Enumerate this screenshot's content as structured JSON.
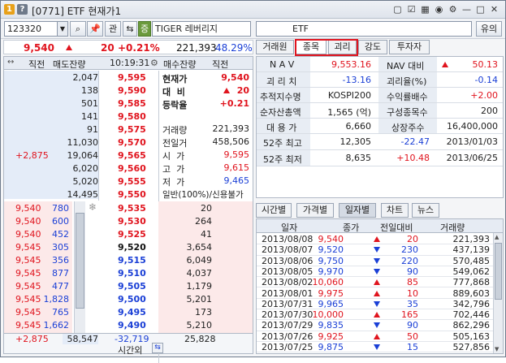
{
  "window": {
    "code_label": "[0771]",
    "title": "ETF 현재가1"
  },
  "toolbar": {
    "code": "123320",
    "btn_search": "⌕",
    "btn_pin": "📌",
    "btn_gwan": "관",
    "btn_arrows": "⇆",
    "btn_jeung": "증",
    "name": "TIGER 레버리지",
    "etf_label": "ETF",
    "btn_yui": "유의"
  },
  "price_bar": {
    "price": "9,540",
    "change": "20",
    "pct": "+0.21%",
    "volume": "221,393",
    "ratio": "48.29%"
  },
  "orderbook_header": {
    "c1": "직전",
    "c2": "매도잔량",
    "time": "10:19:31",
    "c4": "매수잔량",
    "c5": "직전"
  },
  "asks": [
    {
      "qty": "2,047",
      "price": "9,595"
    },
    {
      "qty": "138",
      "price": "9,590"
    },
    {
      "qty": "501",
      "price": "9,585"
    },
    {
      "qty": "141",
      "price": "9,580"
    },
    {
      "qty": "91",
      "price": "9,575"
    },
    {
      "qty": "11,030",
      "price": "9,570"
    },
    {
      "prev": "+2,875",
      "qty": "19,064",
      "price": "9,565"
    },
    {
      "qty": "6,020",
      "price": "9,560"
    },
    {
      "qty": "5,020",
      "price": "9,555"
    },
    {
      "qty": "14,495",
      "price": "9,550"
    }
  ],
  "ask_info": {
    "cur_label": "현재가",
    "cur_val": "9,540",
    "diff_label": "대  비",
    "diff_val": "20",
    "rate_label": "등락율",
    "rate_val": "+0.21",
    "items": [
      {
        "label": "거래량",
        "value": "221,393"
      },
      {
        "label": "전일거",
        "value": "458,506"
      },
      {
        "label": "시  가",
        "value": "9,595"
      },
      {
        "label": "고  가",
        "value": "9,615"
      },
      {
        "label": "저  가",
        "value": "9,465"
      }
    ],
    "footer": "일반(100%)/신용불가"
  },
  "bids": [
    {
      "p1": "9,540",
      "p2": "780",
      "price": "9,535",
      "qty": "20"
    },
    {
      "p1": "9,540",
      "p2": "600",
      "price": "9,530",
      "qty": "264"
    },
    {
      "p1": "9,540",
      "p2": "452",
      "price": "9,525",
      "qty": "41"
    },
    {
      "p1": "9,545",
      "p2": "305",
      "price": "9,520",
      "qty": "3,654"
    },
    {
      "p1": "9,545",
      "p2": "356",
      "price": "9,515",
      "qty": "6,049"
    },
    {
      "p1": "9,545",
      "p2": "877",
      "price": "9,510",
      "qty": "4,037"
    },
    {
      "p1": "9,545",
      "p2": "477",
      "price": "9,505",
      "qty": "1,179"
    },
    {
      "p1": "9,545",
      "p2": "1,828",
      "price": "9,500",
      "qty": "5,201"
    },
    {
      "p1": "9,545",
      "p2": "765",
      "price": "9,495",
      "qty": "173"
    },
    {
      "p1": "9,545",
      "p2": "1,662",
      "price": "9,490",
      "qty": "5,210"
    }
  ],
  "ob_footer": {
    "prev": "+2,875",
    "ask_total": "58,547",
    "diff": "-32,719",
    "bid_total": "25,828",
    "time_label": "시간외"
  },
  "right_tabs": [
    "거래원",
    "종목",
    "괴리",
    "강도",
    "투자자"
  ],
  "info": [
    {
      "l1": "N A V",
      "v1": "9,553.16",
      "l2": "NAV 대비",
      "v2": "50.13"
    },
    {
      "l1": "괴 리 치",
      "v1": "-13.16",
      "l2": "괴리율(%)",
      "v2": "-0.14"
    },
    {
      "l1": "추적지수명",
      "v1": "KOSPI200",
      "l2": "수익률배수",
      "v2": "+2.00"
    },
    {
      "l1": "순자산총액",
      "v1": "1,565 (억)",
      "l2": "구성종목수",
      "v2": "200"
    },
    {
      "l1": "대 용 가",
      "v1": "6,660",
      "l2": "상장주수",
      "v2": "16,400,000"
    },
    {
      "l1": "52주 최고",
      "v1": "12,305",
      "l2": "-22.47",
      "v2": "2013/01/03"
    },
    {
      "l1": "52주 최저",
      "v1": "8,635",
      "l2": "+10.48",
      "v2": "2013/06/25"
    }
  ],
  "sub_tabs": [
    "시간별",
    "가격별",
    "일자별",
    "차트",
    "뉴스"
  ],
  "list_head": {
    "date": "일자",
    "close": "종가",
    "change": "전일대비",
    "volume": "거래량"
  },
  "daily": [
    {
      "date": "2013/08/08",
      "close": "9,540",
      "dir": "up",
      "change": "20",
      "volume": "221,393"
    },
    {
      "date": "2013/08/07",
      "close": "9,520",
      "dir": "down",
      "change": "230",
      "volume": "437,139"
    },
    {
      "date": "2013/08/06",
      "close": "9,750",
      "dir": "down",
      "change": "220",
      "volume": "570,485"
    },
    {
      "date": "2013/08/05",
      "close": "9,970",
      "dir": "down",
      "change": "90",
      "volume": "549,062"
    },
    {
      "date": "2013/08/02",
      "close": "10,060",
      "dir": "up",
      "change": "85",
      "volume": "777,868"
    },
    {
      "date": "2013/08/01",
      "close": "9,975",
      "dir": "up",
      "change": "10",
      "volume": "889,603"
    },
    {
      "date": "2013/07/31",
      "close": "9,965",
      "dir": "down",
      "change": "35",
      "volume": "342,796"
    },
    {
      "date": "2013/07/30",
      "close": "10,000",
      "dir": "up",
      "change": "165",
      "volume": "702,446"
    },
    {
      "date": "2013/07/29",
      "close": "9,835",
      "dir": "down",
      "change": "90",
      "volume": "862,296"
    },
    {
      "date": "2013/07/26",
      "close": "9,925",
      "dir": "up",
      "change": "50",
      "volume": "505,163"
    },
    {
      "date": "2013/07/25",
      "close": "9,875",
      "dir": "down",
      "change": "15",
      "volume": "527,856"
    }
  ],
  "colors": {
    "up": "#e0141e",
    "down": "#1a3fd6",
    "highlight": "#e0141e"
  }
}
